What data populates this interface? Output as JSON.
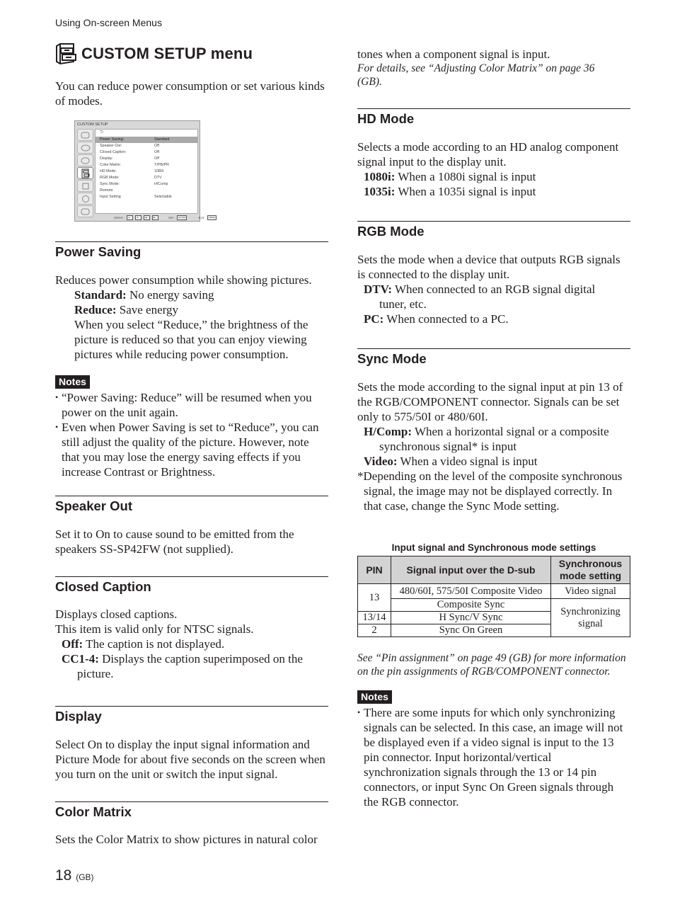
{
  "running_head": "Using On-screen Menus",
  "page_title": "CUSTOM SETUP menu",
  "intro": "You can reduce power consumption or set various kinds of modes.",
  "osd_menu": {
    "title": "CUSTOM SETUP",
    "back_symbol": "⮌",
    "rows": [
      {
        "label": "Power Saving:",
        "value": "Standard",
        "selected": true
      },
      {
        "label": "Speaker Out:",
        "value": "Off"
      },
      {
        "label": "Closed Caption:",
        "value": "Off"
      },
      {
        "label": "Display:",
        "value": "Off"
      },
      {
        "label": "Color Matrix:",
        "value": "Y/PB/PR"
      },
      {
        "label": "HD Mode:",
        "value": "1080i"
      },
      {
        "label": "RGB Mode:",
        "value": "DTV"
      },
      {
        "label": "Sync Mode:",
        "value": "H/Comp"
      },
      {
        "label": "Remote",
        "value": ""
      },
      {
        "label": "Input Setting",
        "value": "Selectable"
      }
    ],
    "footer": {
      "select_label": "Select :",
      "set_label": "Set :",
      "set_key": "ENTER",
      "exit_label": "Exit :",
      "exit_key": "MENU"
    }
  },
  "sections": {
    "power_saving": {
      "heading": "Power Saving",
      "desc": "Reduces power consumption while showing pictures.",
      "options": [
        {
          "term": "Standard:",
          "text": " No energy saving"
        },
        {
          "term": "Reduce:",
          "text": " Save energy"
        }
      ],
      "extra": "When you select “Reduce,” the brightness of the picture is reduced so that you can enjoy viewing pictures while reducing power consumption.",
      "notes_label": "Notes",
      "notes": [
        "“Power Saving: Reduce” will be resumed when you power on the unit again.",
        "Even when Power Saving is set to “Reduce”, you can still adjust the quality of the picture. However, note that you may lose the energy saving effects if you increase Contrast or Brightness."
      ]
    },
    "speaker_out": {
      "heading": "Speaker Out",
      "desc": "Set it to On to cause sound to be emitted from the speakers SS-SP42FW (not supplied)."
    },
    "closed_caption": {
      "heading": "Closed Caption",
      "desc1": "Displays closed captions.",
      "desc2": "This item is valid only for NTSC signals.",
      "options": [
        {
          "term": "Off:",
          "text": " The caption is not displayed."
        },
        {
          "term": "CC1-4:",
          "text": " Displays the caption superimposed on the picture."
        }
      ]
    },
    "display": {
      "heading": "Display",
      "desc": "Select On to display the input signal information and Picture Mode for about five seconds on the screen when you turn on the unit or switch the input signal."
    },
    "color_matrix": {
      "heading": "Color Matrix",
      "desc_part1": "Sets the Color Matrix to show pictures in natural color",
      "desc_part2": "tones when a component signal is input.",
      "ref": "For details, see “Adjusting Color Matrix” on page 36 (GB)."
    },
    "hd_mode": {
      "heading": "HD Mode",
      "desc": "Selects a mode according to an HD analog component signal input to the display unit.",
      "options": [
        {
          "term": "1080i:",
          "text": " When a 1080i signal is input"
        },
        {
          "term": "1035i:",
          "text": " When a 1035i signal is input"
        }
      ]
    },
    "rgb_mode": {
      "heading": "RGB Mode",
      "desc": "Sets the mode when a device that outputs RGB signals is connected to the display unit.",
      "options": [
        {
          "term": "DTV:",
          "text": " When connected to an RGB signal digital tuner, etc."
        },
        {
          "term": "PC:",
          "text": " When connected to a PC."
        }
      ]
    },
    "sync_mode": {
      "heading": "Sync Mode",
      "desc": "Sets the mode according to the signal input at pin 13 of the RGB/COMPONENT connector. Signals can be set only to 575/50I or 480/60I.",
      "options": [
        {
          "term": "H/Comp:",
          "text": " When a horizontal signal or a composite synchronous signal* is input"
        },
        {
          "term": "Video:",
          "text": " When a video signal is input"
        }
      ],
      "footnote": "*Depending on the level of the composite synchronous signal, the image may not be displayed correctly. In that case, change the Sync Mode setting.",
      "table": {
        "caption": "Input signal and Synchronous mode settings",
        "headers": [
          "PIN",
          "Signal input over the D-sub",
          "Synchronous mode setting"
        ],
        "rows": [
          {
            "pin": "13",
            "signal": "480/60I, 575/50I Composite Video",
            "mode": "Video signal"
          },
          {
            "pin": "",
            "signal": "Composite Sync",
            "mode": "Synchronizing signal"
          },
          {
            "pin": "13/14",
            "signal": "H Sync/V Sync",
            "mode": ""
          },
          {
            "pin": "2",
            "signal": "Sync On Green",
            "mode": ""
          }
        ]
      },
      "ref": "See “Pin assignment” on page 49 (GB) for more information on the pin assignments of RGB/COMPONENT connector.",
      "notes_label": "Notes",
      "notes": [
        "There are some inputs for which only synchronizing signals can be selected. In this case, an image will not be displayed even if a video signal is input to the 13 pin connector. Input horizontal/vertical synchronization signals through the 13 or 14 pin connectors, or input Sync On Green signals through the RGB connector."
      ]
    }
  },
  "page_number": "18",
  "page_suffix": "(GB)"
}
